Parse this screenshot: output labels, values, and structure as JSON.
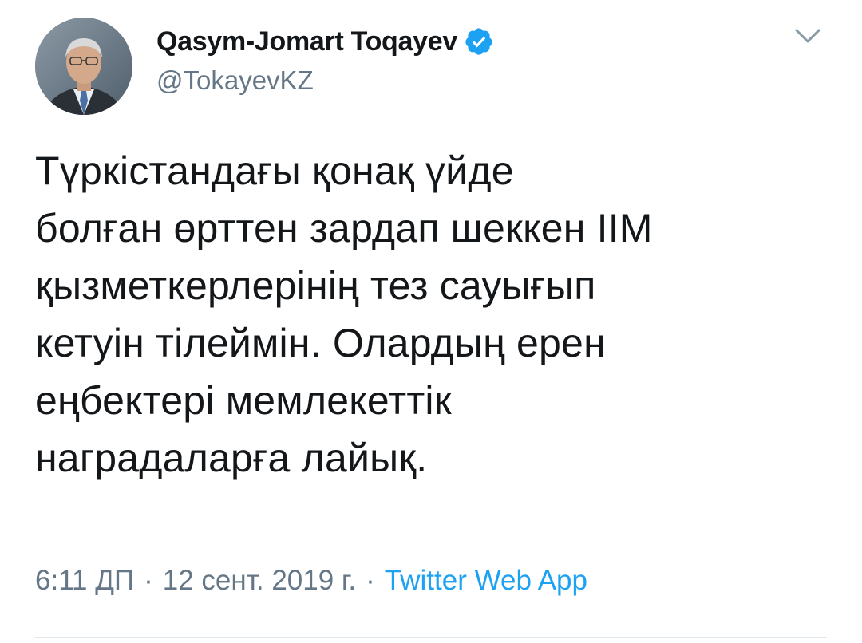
{
  "tweet": {
    "author": {
      "display_name": "Qasym-Jomart Toqayev",
      "handle": "@TokayevKZ",
      "verified": true,
      "avatar_icon": "profile-photo"
    },
    "text": "Түркістандағы қонақ үйде\nболған өрттен зардап шеккен ІІМ\nқызметкерлерінің тез сауығып\nкетуін тілеймін. Олардың ерен\nеңбектері мемлекеттік\nнаградаларға лайық.",
    "time": "6:11 ДП",
    "date": "12 сент. 2019 г.",
    "separator": "·",
    "source": "Twitter Web App",
    "menu_icon": "chevron-down-icon"
  },
  "colors": {
    "text_primary": "#14171a",
    "text_secondary": "#657786",
    "accent": "#1da1f2",
    "divider": "#e1e8ed"
  }
}
